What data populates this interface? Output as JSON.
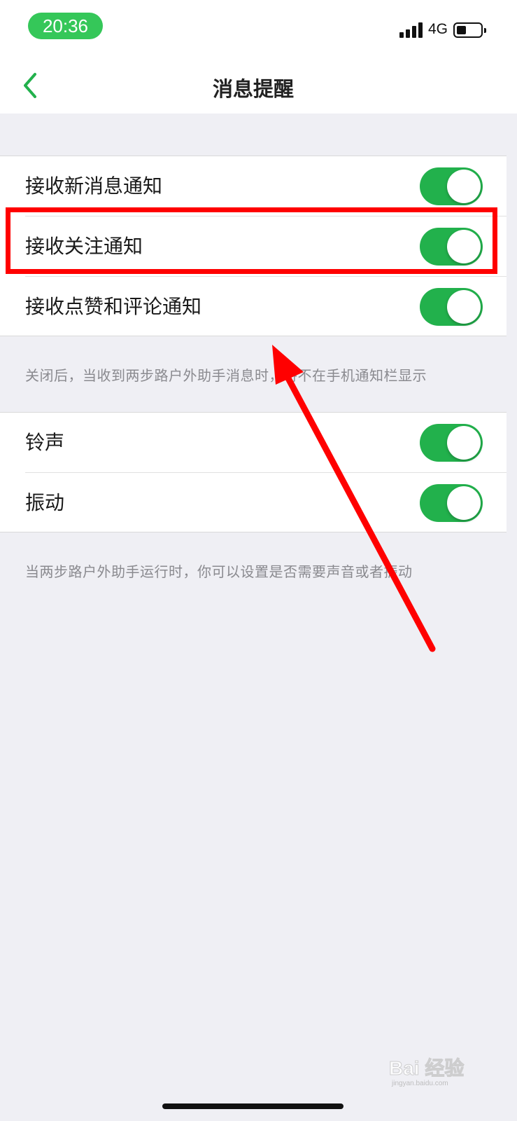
{
  "status_bar": {
    "time": "20:36",
    "network": "4G",
    "icons": [
      "signal-icon",
      "battery-icon"
    ]
  },
  "nav": {
    "back_icon": "chevron-left-icon",
    "title": "消息提醒"
  },
  "section1": {
    "items": [
      {
        "label": "接收新消息通知",
        "enabled": true
      },
      {
        "label": "接收关注通知",
        "enabled": true
      },
      {
        "label": "接收点赞和评论通知",
        "enabled": true
      }
    ],
    "note": "关闭后，当收到两步路户外助手消息时，将不在手机通知栏显示"
  },
  "section2": {
    "items": [
      {
        "label": "铃声",
        "enabled": true
      },
      {
        "label": "振动",
        "enabled": true
      }
    ],
    "note": "当两步路户外助手运行时，你可以设置是否需要声音或者振动"
  },
  "watermark": {
    "text": "Bai 经验",
    "subtext": "jingyan.baidu.com"
  },
  "colors": {
    "accent": "#22b14c",
    "time_pill": "#35c759",
    "annotation": "#ff0000",
    "background": "#efeff4"
  }
}
